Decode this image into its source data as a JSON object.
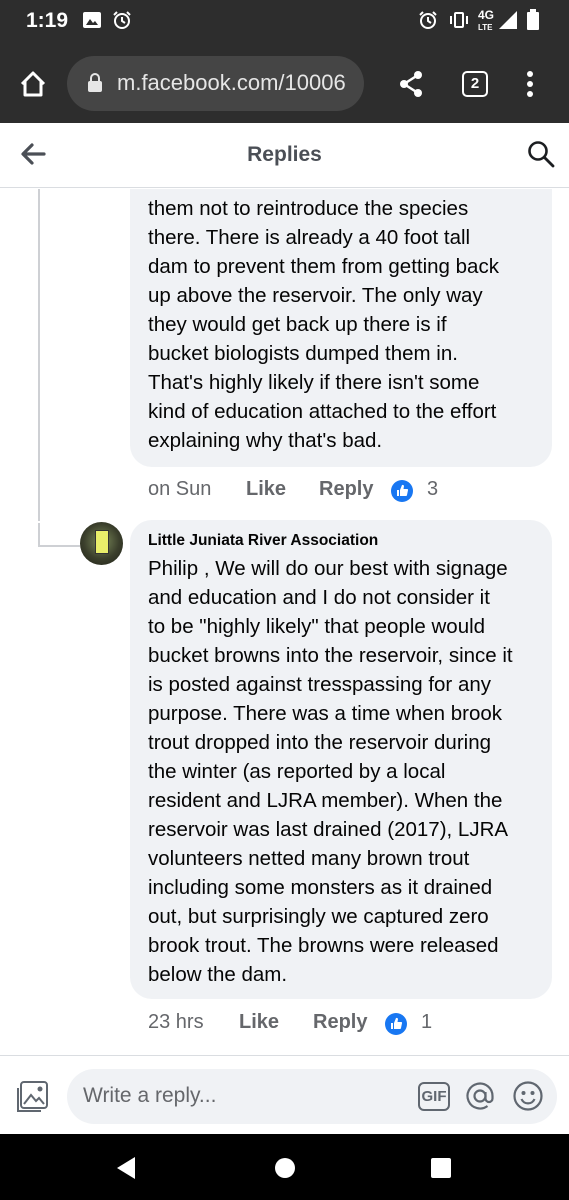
{
  "status_bar": {
    "time": "1:19",
    "network": "4G"
  },
  "browser": {
    "url": "m.facebook.com/10006",
    "tab_count": "2"
  },
  "header": {
    "title": "Replies"
  },
  "comments": [
    {
      "text": "them not to reintroduce the species\nthere.  There is already a 40 foot tall\ndam to prevent them from getting back\nup above the reservoir. The only way\nthey would get back up there is if\nbucket biologists dumped them in.\nThat's highly likely if there isn't some\nkind of education attached to the effort\nexplaining why that's bad.",
      "time": "on Sun",
      "like_label": "Like",
      "reply_label": "Reply",
      "reactions": "3"
    },
    {
      "author": "Little Juniata River Association",
      "text": "Philip ,  We will do our best with signage\nand education and I do not consider it\nto be \"highly likely\" that people would\nbucket browns into the reservoir, since it\nis posted against tresspassing for any\npurpose. There was a time when brook\ntrout dropped into the reservoir during\nthe winter (as reported by a local\nresident and LJRA member). When the\nreservoir was last drained (2017), LJRA\nvolunteers netted many brown trout\nincluding some monsters as it drained\nout, but surprisingly we captured zero\nbrook trout. The browns were released\nbelow the dam.",
      "time": "23 hrs",
      "like_label": "Like",
      "reply_label": "Reply",
      "reactions": "1"
    }
  ],
  "composer": {
    "placeholder": "Write a reply...",
    "gif_label": "GIF"
  },
  "icons": {
    "home": "home-icon",
    "lock": "lock-icon",
    "share": "share-icon",
    "more": "more-vert-icon",
    "back": "back-arrow-icon",
    "search": "search-icon",
    "photo": "photo-icon",
    "mention": "mention-icon",
    "emoji": "emoji-icon",
    "like": "thumbs-up-icon",
    "nav_back": "nav-back-icon",
    "nav_home": "nav-home-icon",
    "nav_recents": "nav-recents-icon"
  },
  "colors": {
    "accent": "#1877f2",
    "bubble": "#f0f2f5",
    "secondary_text": "#65676b"
  }
}
